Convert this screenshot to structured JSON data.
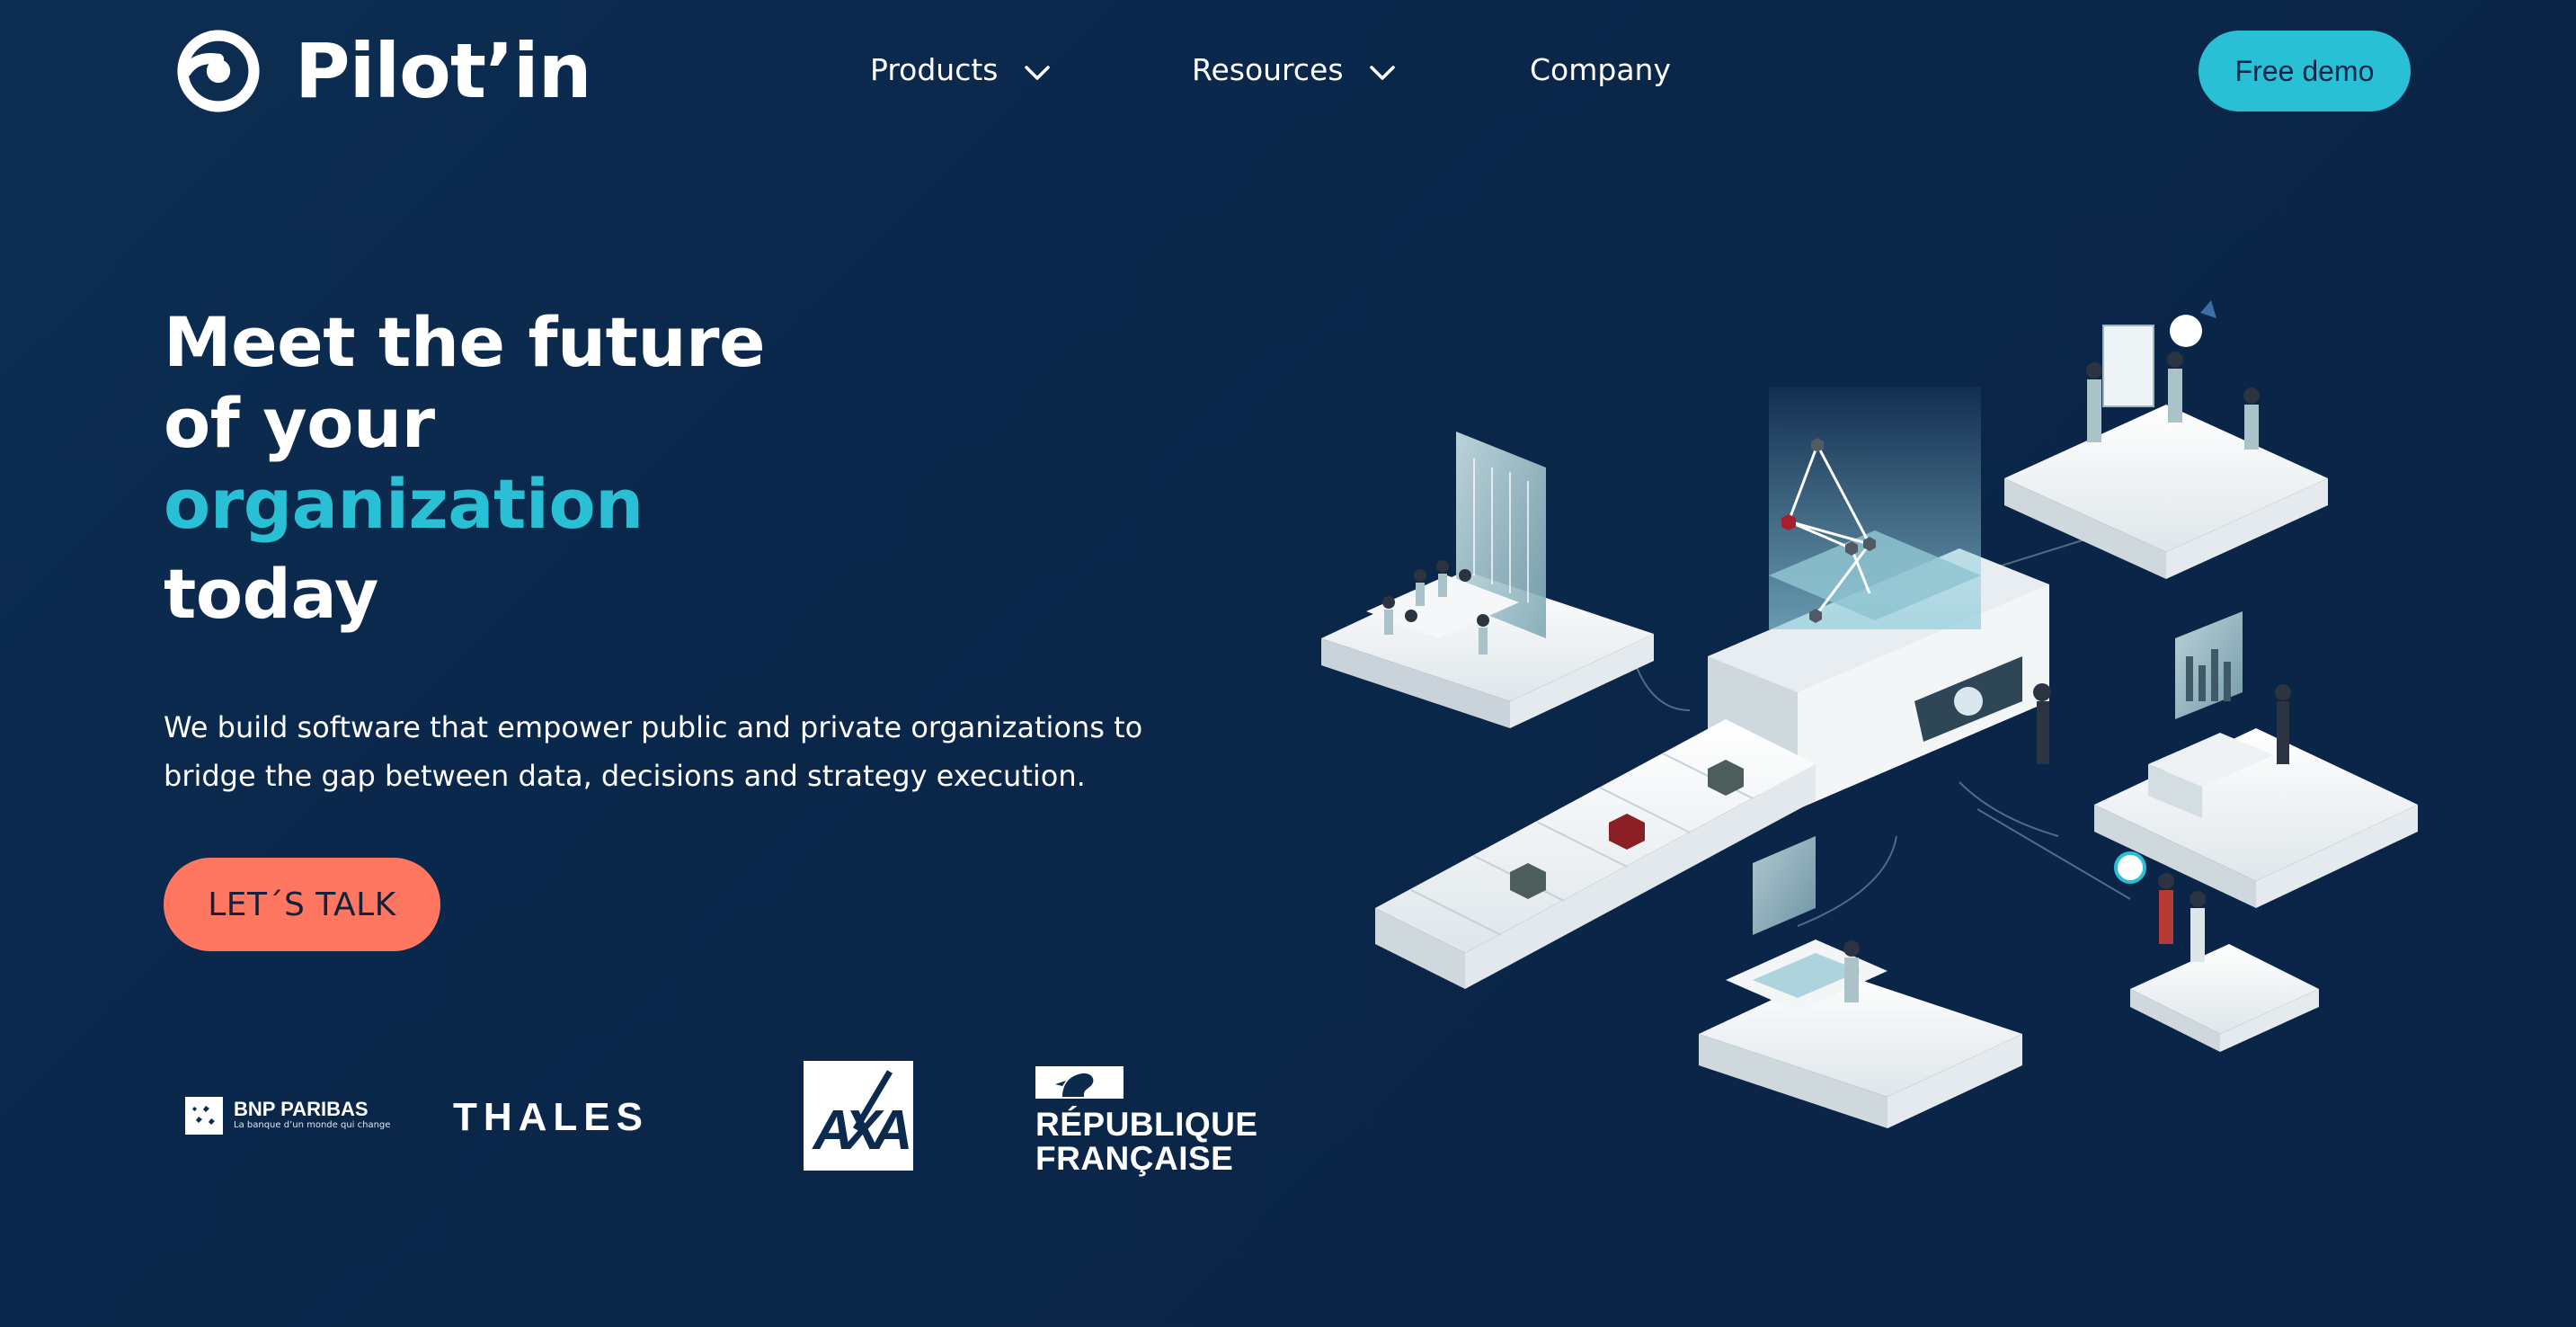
{
  "brand": {
    "name": "Pilot’in"
  },
  "nav": {
    "items": [
      {
        "label": "Products",
        "has_dropdown": true
      },
      {
        "label": "Resources",
        "has_dropdown": true
      },
      {
        "label": "Company",
        "has_dropdown": false
      }
    ],
    "cta_label": "Free demo"
  },
  "hero": {
    "title_line1": "Meet the future",
    "title_line2": "of your",
    "title_accent": "organization",
    "title_line4": "today",
    "subtitle_line1": "We build software that empower public and private organizations to",
    "subtitle_line2": "bridge the gap between data, decisions and strategy execution.",
    "cta_label": "LET´S TALK"
  },
  "logos": {
    "bnp": {
      "name": "BNP PARIBAS",
      "tagline": "La banque d’un monde qui change"
    },
    "thales": {
      "name": "THALES"
    },
    "axa": {
      "name": "AXA"
    },
    "rf": {
      "line1": "RÉPUBLIQUE",
      "line2": "FRANÇAISE"
    }
  },
  "colors": {
    "background": "#0b2a4e",
    "accent": "#29c0d6",
    "cta": "#ff7761",
    "text": "#ffffff"
  },
  "icons": {
    "brand": "pilotin-logo-icon",
    "dropdown": "chevron-down-icon"
  }
}
